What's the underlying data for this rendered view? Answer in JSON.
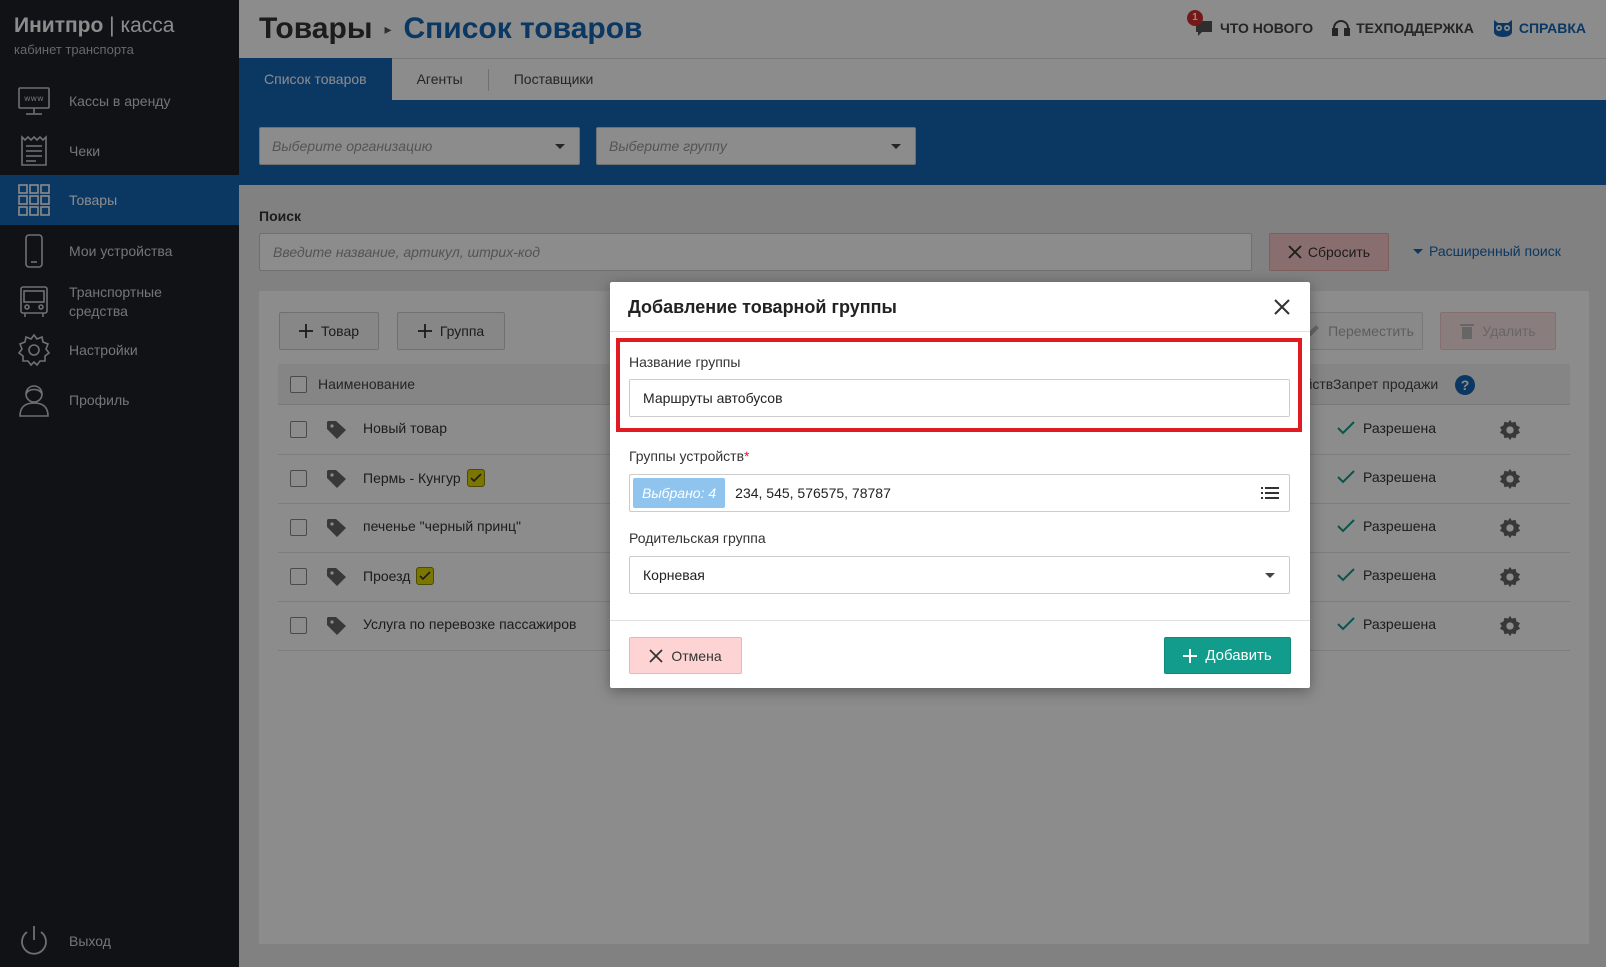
{
  "brand": {
    "name_bold": "Инитпро",
    "name_sep": " | ",
    "name_light": "касса",
    "subtitle": "кабинет транспорта"
  },
  "sidebar": {
    "items": [
      {
        "label": "Кассы в аренду",
        "icon": "monitor-www-icon"
      },
      {
        "label": "Чеки",
        "icon": "receipt-icon"
      },
      {
        "label": "Товары",
        "icon": "grid-icon",
        "active": true
      },
      {
        "label": "Мои устройства",
        "icon": "phone-icon"
      },
      {
        "label": "Транспортные средства",
        "icon": "bus-icon"
      },
      {
        "label": "Настройки",
        "icon": "gear-icon"
      },
      {
        "label": "Профиль",
        "icon": "user-icon"
      }
    ],
    "logout": {
      "label": "Выход",
      "icon": "power-icon"
    }
  },
  "header": {
    "breadcrumb_root": "Товары",
    "breadcrumb_current": "Список товаров",
    "links": {
      "whats_new": "ЧТО НОВОГО",
      "whats_new_count": "1",
      "support": "ТЕХПОДДЕРЖКА",
      "help": "СПРАВКА"
    }
  },
  "tabs": [
    "Список товаров",
    "Агенты",
    "Поставщики"
  ],
  "filters": {
    "org_placeholder": "Выберите организацию",
    "group_placeholder": "Выберите группу"
  },
  "search": {
    "label": "Поиск",
    "placeholder": "Введите название, артикул, штрих-код",
    "reset_label": "Сбросить",
    "advanced_label": "Расширенный поиск"
  },
  "toolbar": {
    "add_product": "Товар",
    "add_group": "Группа",
    "move": "Переместить",
    "delete": "Удалить"
  },
  "table": {
    "columns": {
      "name": "Наименование",
      "devices_partial": "ройств",
      "sale_ban": "Запрет продажи"
    },
    "rows": [
      {
        "name": "Новый товар",
        "badge": false,
        "status": "Разрешена"
      },
      {
        "name": "Пермь - Кунгур",
        "badge": true,
        "status": "Разрешена"
      },
      {
        "name": "печенье \"черный принц\"",
        "badge": false,
        "status": "Разрешена"
      },
      {
        "name": "Проезд",
        "badge": true,
        "status": "Разрешена"
      },
      {
        "name": "Услуга по перевозке пассажиров",
        "badge": false,
        "status": "Разрешена"
      }
    ]
  },
  "modal": {
    "title": "Добавление товарной группы",
    "group_name_label": "Название группы",
    "group_name_value": "Маршруты автобусов",
    "device_groups_label": "Группы устройств",
    "required_mark": "*",
    "selected_chip": "Выбрано: 4",
    "selected_values": "234, 545, 576575, 78787",
    "parent_group_label": "Родительская группа",
    "parent_group_value": "Корневая",
    "cancel_label": "Отмена",
    "add_label": "Добавить"
  },
  "colors": {
    "primary": "#1565b5",
    "sidebar_bg": "#1f2128",
    "success": "#129c8b",
    "danger_outline": "#e01b24"
  }
}
